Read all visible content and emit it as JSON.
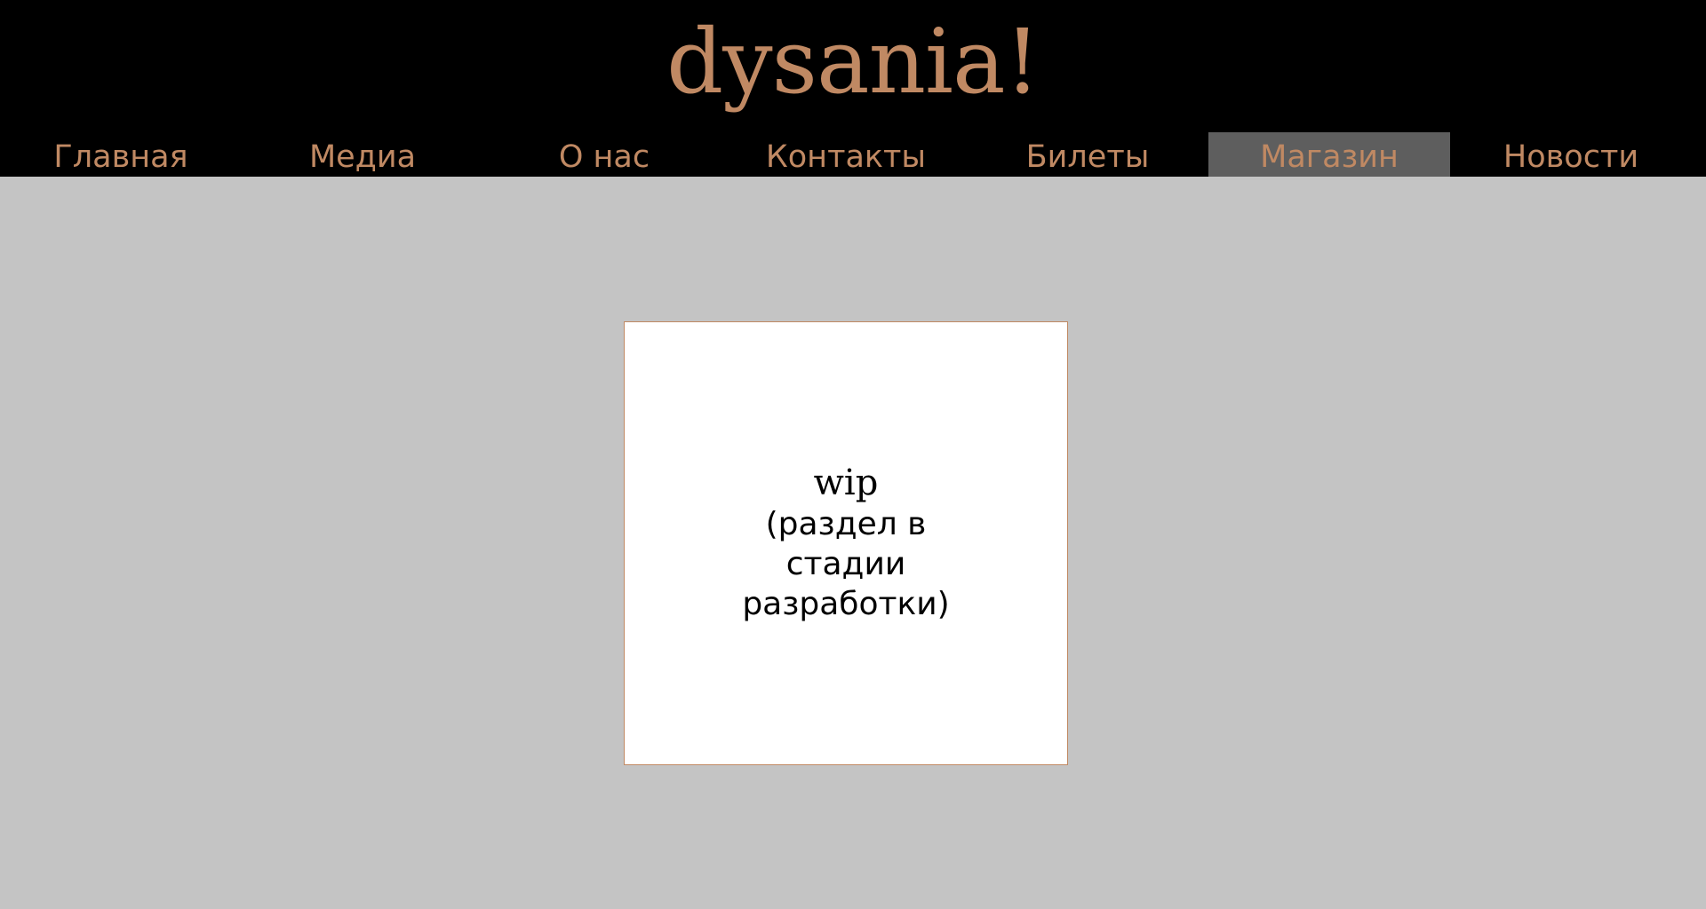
{
  "site": {
    "logo": "dysania!"
  },
  "nav": {
    "items": [
      {
        "label": "Главная"
      },
      {
        "label": "Медиа"
      },
      {
        "label": "О нас"
      },
      {
        "label": "Контакты"
      },
      {
        "label": "Билеты"
      },
      {
        "label": "Магазин",
        "active": true
      },
      {
        "label": "Новости"
      }
    ]
  },
  "main": {
    "card": {
      "title": "wip",
      "description": "(раздел в стадии разработки)"
    }
  },
  "colors": {
    "accent": "#c08963",
    "header_bg": "#000000",
    "page_bg": "#c4c4c4",
    "active_nav_bg": "#5e5e5e",
    "card_bg": "#ffffff"
  }
}
